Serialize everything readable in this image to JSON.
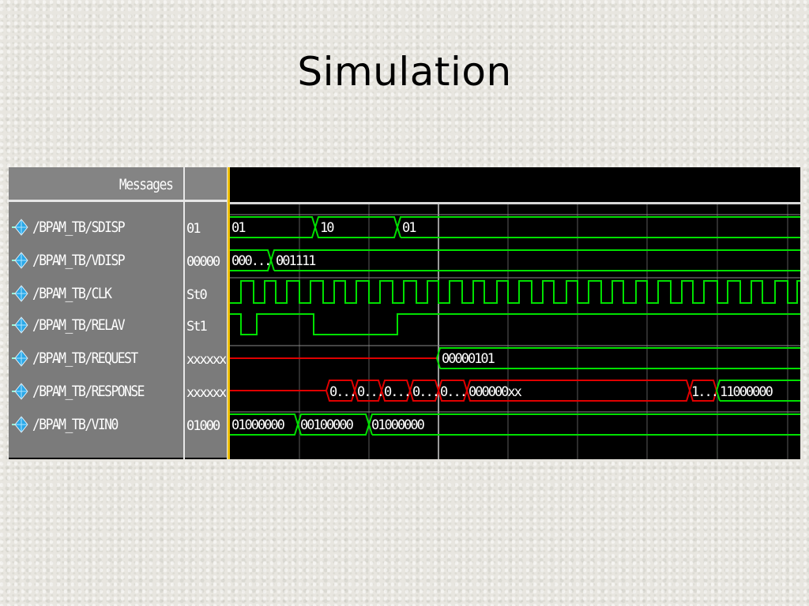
{
  "slide": {
    "title": "Simulation"
  },
  "wave": {
    "messages_header": "Messages",
    "signals": [
      {
        "name": "/BPAM_TB/SDISP",
        "value": "01",
        "icon": "diamond-signal-icon"
      },
      {
        "name": "/BPAM_TB/VDISP",
        "value": "00000",
        "icon": "diamond-signal-icon"
      },
      {
        "name": "/BPAM_TB/CLK",
        "value": "St0",
        "icon": "diamond-signal-icon"
      },
      {
        "name": "/BPAM_TB/RELAV",
        "value": "St1",
        "icon": "diamond-signal-icon"
      },
      {
        "name": "/BPAM_TB/REQUEST",
        "value": "xxxxxx",
        "icon": "diamond-signal-icon"
      },
      {
        "name": "/BPAM_TB/RESPONSE",
        "value": "xxxxxx",
        "icon": "diamond-signal-icon"
      },
      {
        "name": "/BPAM_TB/VIN0",
        "value": "01000",
        "icon": "diamond-signal-icon"
      }
    ],
    "bus_labels": {
      "sdisp": [
        "01",
        "10",
        "01"
      ],
      "vdisp": [
        "000...",
        "001111"
      ],
      "request": [
        "00000101"
      ],
      "response": [
        "0...",
        "0...",
        "0...",
        "0...",
        "0...",
        "000000xx",
        "1...",
        "11000000"
      ],
      "vin0": [
        "01000000",
        "00100000",
        "01000000"
      ]
    },
    "colors": {
      "trace": "#00e000",
      "undefined": "#e00000",
      "background": "#000000",
      "pane": "#7b7b7b",
      "cursor": "#f0c000",
      "icon": "#2aa8e8"
    }
  }
}
